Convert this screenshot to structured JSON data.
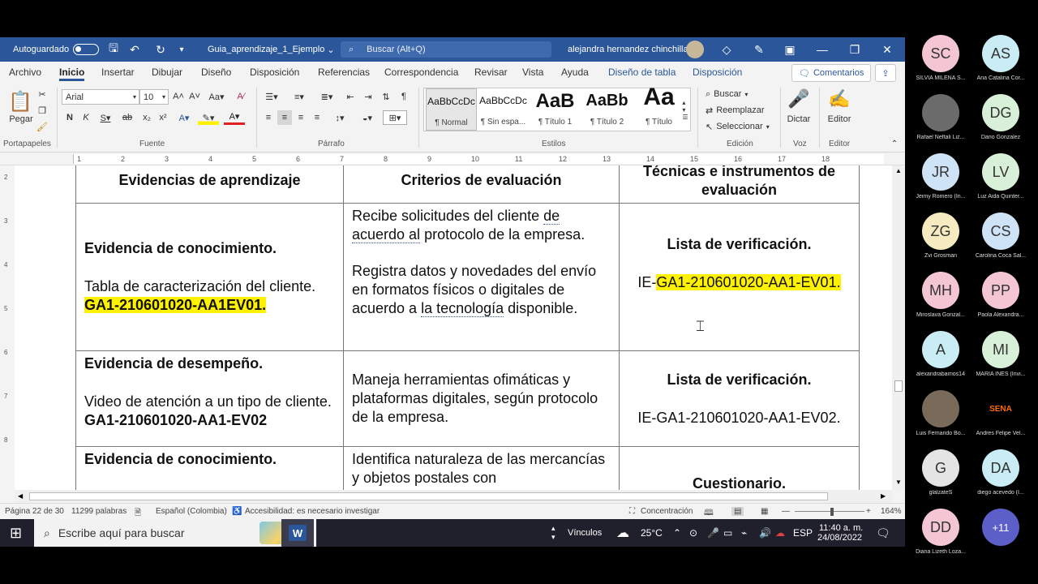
{
  "titlebar": {
    "autosave_label": "Autoguardado",
    "doc_name": "Guia_aprendizaje_1_Ejemplo",
    "search_placeholder": "Buscar (Alt+Q)",
    "user_name": "alejandra hernandez chinchilla"
  },
  "menu": {
    "tabs": [
      "Archivo",
      "Inicio",
      "Insertar",
      "Dibujar",
      "Diseño",
      "Disposición",
      "Referencias",
      "Correspondencia",
      "Revisar",
      "Vista",
      "Ayuda",
      "Diseño de tabla",
      "Disposición"
    ],
    "comments_label": "Comentarios"
  },
  "ribbon": {
    "paste_label": "Pegar",
    "font_name": "Arial",
    "font_size": "10",
    "styles": [
      {
        "sample": "AaBbCcDc",
        "name": "¶ Normal"
      },
      {
        "sample": "AaBbCcDc",
        "name": "¶ Sin espa..."
      },
      {
        "sample": "AaB",
        "name": "¶ Título 1"
      },
      {
        "sample": "AaBb",
        "name": "¶ Título 2"
      },
      {
        "sample": "Aa",
        "name": "¶ Título"
      }
    ],
    "find_label": "Buscar",
    "replace_label": "Reemplazar",
    "select_label": "Seleccionar",
    "dictate_label": "Dictar",
    "editor_label": "Editor",
    "groups": {
      "clipboard": "Portapapeles",
      "font": "Fuente",
      "paragraph": "Párrafo",
      "styles": "Estilos",
      "editing": "Edición",
      "voice": "Voz",
      "editor": "Editor"
    }
  },
  "table": {
    "headers": [
      "Evidencias de aprendizaje",
      "Criterios de evaluación",
      "Técnicas e instrumentos de evaluación"
    ],
    "row1": {
      "ev_title": "Evidencia de conocimiento.",
      "ev_desc": "Tabla de caracterización del cliente.",
      "ev_code": "GA1-210601020-AA1EV01.",
      "crit_1a": "Recibe solicitudes del cliente",
      "crit_1b": "de",
      "crit_1c": "acuerdo al",
      "crit_1d": "protocolo de la empresa.",
      "crit_2a": "Registra datos y novedades del envío en formatos físicos o digitales de acuerdo a",
      "crit_2b": "la tecnología",
      "crit_2c": "disponible.",
      "tech_title": "Lista de verificación.",
      "tech_prefix": "IE-",
      "tech_code": "GA1-210601020-AA1-EV01."
    },
    "row2": {
      "ev_title": "Evidencia de desempeño.",
      "ev_desc": "Video de atención a un tipo de cliente.",
      "ev_code": "GA1-210601020-AA1-EV02",
      "crit": "Maneja herramientas ofimáticas y plataformas digitales, según protocolo de la empresa.",
      "tech_title": "Lista de verificación.",
      "tech_code": "IE-GA1-210601020-AA1-EV02."
    },
    "row3": {
      "ev_title": "Evidencia de conocimiento.",
      "crit": "Identifica naturaleza de las mercancías y objetos postales con",
      "tech_title": "Cuestionario."
    }
  },
  "status": {
    "page": "Página 22 de 30",
    "words": "11299 palabras",
    "language": "Español (Colombia)",
    "accessibility": "Accesibilidad: es necesario investigar",
    "focus": "Concentración",
    "zoom": "164%"
  },
  "taskbar": {
    "search_placeholder": "Escribe aquí para buscar",
    "links": "Vínculos",
    "temperature": "25°C",
    "lang": "ESP",
    "time": "11:40 a. m.",
    "date": "24/08/2022"
  },
  "participants": [
    {
      "initials": "SC",
      "name": "SILVIA MILENA S...",
      "color": "#f4c6d4"
    },
    {
      "initials": "AS",
      "name": "Ana Catalina Cor...",
      "color": "#c9ecf5"
    },
    {
      "initials": "",
      "name": "Rafael Neftali Liz...",
      "color": "#6b6b6b"
    },
    {
      "initials": "DG",
      "name": "Dario Gonzalez",
      "color": "#d9f0d8"
    },
    {
      "initials": "JR",
      "name": "Jeimy Romero (In...",
      "color": "#cfe3f6"
    },
    {
      "initials": "LV",
      "name": "Luz Aida Quinter...",
      "color": "#d9f0d8"
    },
    {
      "initials": "ZG",
      "name": "Zvi Grosman",
      "color": "#f6ebc0"
    },
    {
      "initials": "CS",
      "name": "Carolina Coca Sal...",
      "color": "#cfe3f6"
    },
    {
      "initials": "MH",
      "name": "Miroslava Gonzal...",
      "color": "#f4c6d4"
    },
    {
      "initials": "PP",
      "name": "Paola Alexandra...",
      "color": "#f4c6d4"
    },
    {
      "initials": "A",
      "name": "alexandrabarrios14",
      "color": "#c9ecf5"
    },
    {
      "initials": "MI",
      "name": "MARÍA INÉS (Invi...",
      "color": "#d9f0d8"
    },
    {
      "initials": "",
      "name": "Luis Fernando Bo...",
      "color": "#7a6a5a"
    },
    {
      "initials": "SENA",
      "name": "Andres Felipe Vel...",
      "color": "#000000"
    },
    {
      "initials": "G",
      "name": "glalzateS",
      "color": "#e4e4e4"
    },
    {
      "initials": "DA",
      "name": "diego acevedo (I...",
      "color": "#c9ecf5"
    },
    {
      "initials": "DD",
      "name": "Diana Lizeth Loza...",
      "color": "#f4c6d4"
    },
    {
      "initials": "+11",
      "name": "",
      "color": "#5b5fc7"
    }
  ]
}
